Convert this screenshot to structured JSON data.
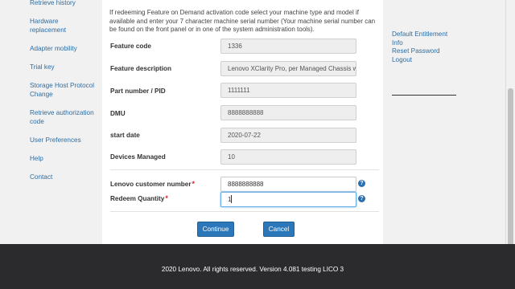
{
  "left_nav": {
    "items": [
      {
        "label": "Retrieve history"
      },
      {
        "label": "Hardware replacement"
      },
      {
        "label": "Adapter mobility"
      },
      {
        "label": "Trial key"
      },
      {
        "label": "Storage Host Protocol Change"
      },
      {
        "label": "Retrieve authorization code"
      },
      {
        "label": "User Preferences"
      },
      {
        "label": "Help"
      },
      {
        "label": "Contact"
      }
    ]
  },
  "form": {
    "intro": "If redeeming Feature on Demand activation code select your machine type and model if available and enter your 7 character machine serial number (Your machine serial number can be found on the front panel or in one of the system administration tools).",
    "fields": [
      {
        "label": "Feature code",
        "value": "1336"
      },
      {
        "label": "Feature description",
        "value": "Lenovo XClarity Pro, per Managed Chassis w"
      },
      {
        "label": "Part number / PID",
        "value": "1111111"
      },
      {
        "label": "DMU",
        "value": "8888888888"
      },
      {
        "label": "start date",
        "value": "2020-07-22"
      },
      {
        "label": "Devices Managed",
        "value": "10"
      }
    ],
    "customer_number": {
      "label": "Lenovo customer number",
      "required_mark": "*",
      "value": "8888888888",
      "help_icon": "?"
    },
    "redeem_quantity": {
      "label": "Redeem Quantity",
      "required_mark": "*",
      "value": "1",
      "help_icon": "?"
    },
    "continue_label": "Continue",
    "cancel_label": "Cancel"
  },
  "right_nav": {
    "items": [
      {
        "label": "Default Entitlement Info"
      },
      {
        "label": "Reset Password"
      },
      {
        "label": "Logout"
      }
    ]
  },
  "footer": {
    "text": "2020 Lenovo. All rights reserved. Version 4.081 testing LICO 3"
  },
  "colors": {
    "accent": "#2b77b9",
    "link": "#2d6da3",
    "required": "#d9232e",
    "footer_bg": "#2b2b2e"
  }
}
